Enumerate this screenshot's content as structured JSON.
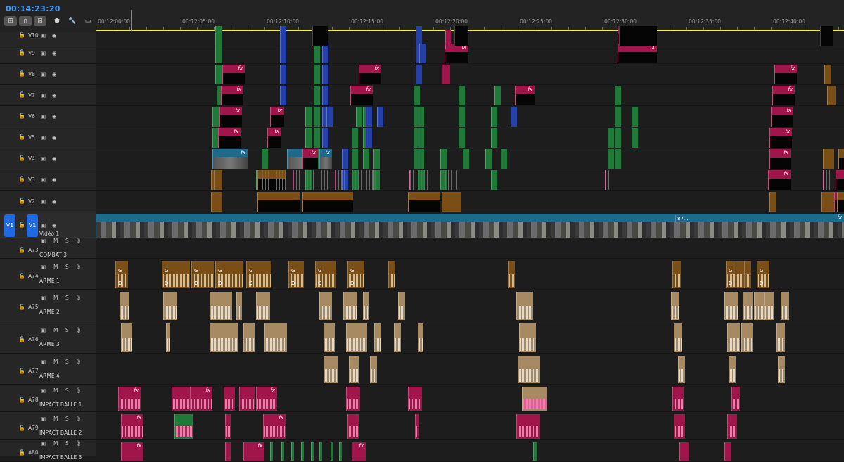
{
  "timecode": "00:14:23:20",
  "toolbar": [
    {
      "icon": "insert-overwrite-icon",
      "glyph": "⊞",
      "active": true
    },
    {
      "icon": "snap-magnet-icon",
      "glyph": "∩",
      "active": true
    },
    {
      "icon": "linked-selection-icon",
      "glyph": "⊠",
      "active": true
    },
    {
      "icon": "add-marker-icon",
      "glyph": "⬟",
      "active": false
    },
    {
      "icon": "timeline-settings-wrench-icon",
      "glyph": "🔧",
      "active": false
    },
    {
      "icon": "captions-icon",
      "glyph": "▭",
      "active": false
    }
  ],
  "ruler": {
    "labels": [
      "00:12:00:00",
      "00:12:05:00",
      "00:12:10:00",
      "00:12:15:00",
      "00:12:20:00",
      "00:12:25:00",
      "00:12:30:00",
      "00:12:35:00",
      "00:12:40:00"
    ]
  },
  "video_tracks": [
    {
      "name": "V10",
      "label": ""
    },
    {
      "name": "V9",
      "label": ""
    },
    {
      "name": "V8",
      "label": ""
    },
    {
      "name": "V7",
      "label": ""
    },
    {
      "name": "V6",
      "label": ""
    },
    {
      "name": "V5",
      "label": ""
    },
    {
      "name": "V4",
      "label": ""
    },
    {
      "name": "V3",
      "label": ""
    },
    {
      "name": "V2",
      "label": ""
    },
    {
      "name": "V1",
      "label": "Vidéo 1",
      "source_patch": "V1"
    }
  ],
  "audio_tracks": [
    {
      "name": "A73",
      "label": "COMBAT 3"
    },
    {
      "name": "A74",
      "label": "ARME 1"
    },
    {
      "name": "A75",
      "label": "ARME 2"
    },
    {
      "name": "A76",
      "label": "ARME 3"
    },
    {
      "name": "A77",
      "label": "ARME 4"
    },
    {
      "name": "A78",
      "label": "IMPACT BALLE 1"
    },
    {
      "name": "A79",
      "label": "IMPACT BALLE 2"
    },
    {
      "name": "A80",
      "label": "IMPACT BALLE 3"
    }
  ],
  "audio_buttons": {
    "mute": "M",
    "solo": "S"
  },
  "clip_texts": {
    "fx": "fx",
    "g": "G",
    "d": "D",
    "v1_clip": "87..."
  },
  "colors": {
    "green": "#1f7a3a",
    "blue": "#2540a8",
    "magenta": "#a0164a",
    "orange": "#7a4e14",
    "teal": "#1e6a8a",
    "tan": "#a88a62",
    "black": "#050505",
    "pink": "#c0397a"
  }
}
